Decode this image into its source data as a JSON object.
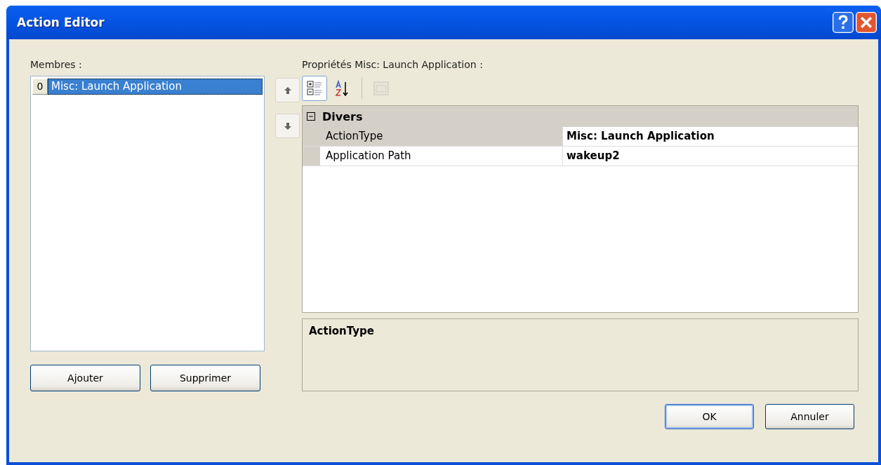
{
  "window": {
    "title": "Action Editor"
  },
  "members": {
    "label": "Membres :",
    "items": [
      {
        "index": "0",
        "name": "Misc: Launch Application",
        "selected": true
      }
    ],
    "add_button": "Ajouter",
    "remove_button": "Supprimer"
  },
  "properties": {
    "label": "Propriétés Misc: Launch Application :",
    "toolbar": [
      {
        "kind": "categorized",
        "selected": true,
        "disabled": false
      },
      {
        "kind": "alphabetical",
        "selected": false,
        "disabled": false
      },
      {
        "kind": "pages",
        "selected": false,
        "disabled": true
      }
    ],
    "category": {
      "name": "Divers",
      "expanded": true,
      "rows": [
        {
          "name": "ActionType",
          "value": "Misc: Launch Application",
          "selected": true
        },
        {
          "name": "Application Path",
          "value": "wakeup2",
          "selected": false
        }
      ]
    },
    "description": {
      "title": "ActionType"
    }
  },
  "buttons": {
    "ok": "OK",
    "cancel": "Annuler"
  }
}
